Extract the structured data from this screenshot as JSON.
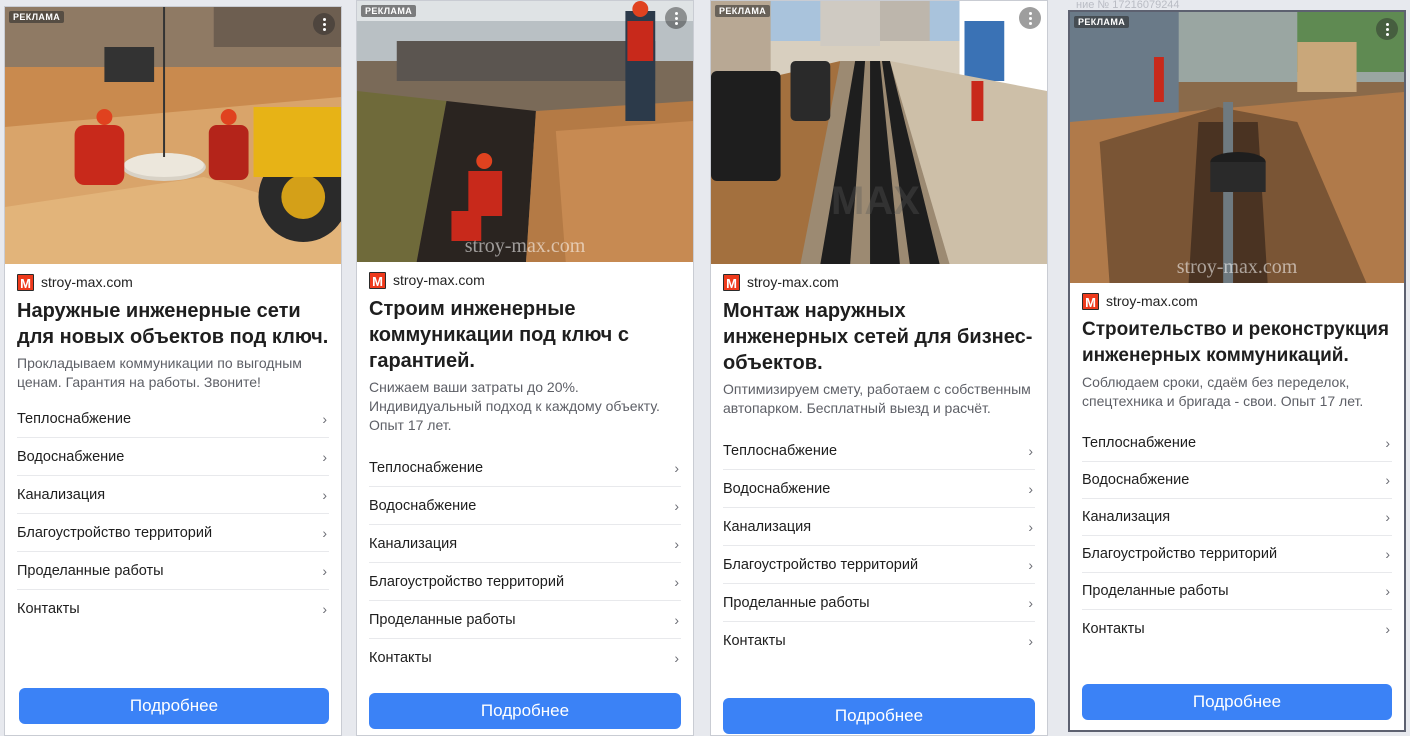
{
  "top_strip": "ние № 17216079244",
  "ads": [
    {
      "label": "РЕКЛАМА",
      "watermark": "",
      "domain": "stroy-max.com",
      "favicon_letter": "M",
      "title": "Наружные инженерные сети для новых объектов под ключ.",
      "desc": "Прокладываем коммуникации по выгодным ценам. Гарантия на работы. Звоните!",
      "links": [
        "Теплоснабжение",
        "Водоснабжение",
        "Канализация",
        "Благоустройство территорий",
        "Проделанные работы",
        "Контакты"
      ],
      "cta": "Подробнее"
    },
    {
      "label": "РЕКЛАМА",
      "watermark": "stroy-max.com",
      "domain": "stroy-max.com",
      "favicon_letter": "M",
      "title": "Строим инженерные коммуникации под ключ с гарантией.",
      "desc": "Снижаем ваши затраты до 20%. Индивидуальный подход к каждому объекту. Опыт 17 лет.",
      "links": [
        "Теплоснабжение",
        "Водоснабжение",
        "Канализация",
        "Благоустройство территорий",
        "Проделанные работы",
        "Контакты"
      ],
      "cta": "Подробнее"
    },
    {
      "label": "РЕКЛАМА",
      "watermark": "MAX",
      "domain": "stroy-max.com",
      "favicon_letter": "M",
      "title": "Монтаж наружных инженерных сетей для бизнес-объектов.",
      "desc": "Оптимизируем смету, работаем с собственным автопарком. Бесплатный выезд и расчёт.",
      "links": [
        "Теплоснабжение",
        "Водоснабжение",
        "Канализация",
        "Благоустройство территорий",
        "Проделанные работы",
        "Контакты"
      ],
      "cta": "Подробнее"
    },
    {
      "label": "РЕКЛАМА",
      "watermark": "stroy-max.com",
      "domain": "stroy-max.com",
      "favicon_letter": "M",
      "title": "Строительство и реконструкция инженерных коммуникаций.",
      "desc": "Соблюдаем сроки, сдаём без переделок, спецтехника и бригада - свои. Опыт 17 лет.",
      "links": [
        "Теплоснабжение",
        "Водоснабжение",
        "Канализация",
        "Благоустройство территорий",
        "Проделанные работы",
        "Контакты"
      ],
      "cta": "Подробнее"
    }
  ]
}
